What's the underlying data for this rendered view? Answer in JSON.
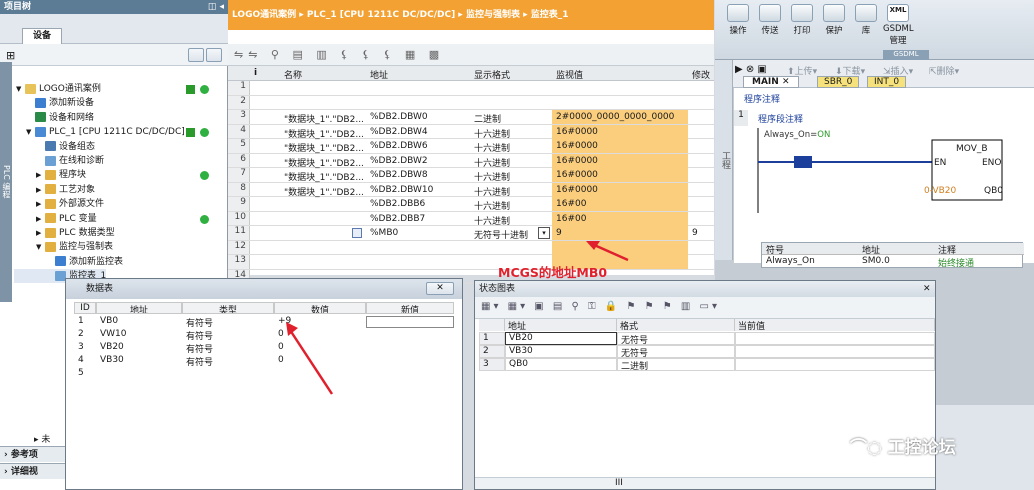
{
  "left": {
    "title": "项目树",
    "tab": "设备",
    "side_label": "PLC 编程",
    "items": [
      {
        "t": "LOGO通讯案例",
        "lvl": 0,
        "ic": "#e8c35a",
        "exp": "▼"
      },
      {
        "t": "添加新设备",
        "lvl": 1,
        "ic": "#3c7fd0"
      },
      {
        "t": "设备和网络",
        "lvl": 1,
        "ic": "#2a8a48"
      },
      {
        "t": "PLC_1 [CPU 1211C DC/DC/DC]",
        "lvl": 1,
        "ic": "#4a8ad4",
        "exp": "▼"
      },
      {
        "t": "设备组态",
        "lvl": 2,
        "ic": "#4a7ab0"
      },
      {
        "t": "在线和诊断",
        "lvl": 2,
        "ic": "#6ba0d4"
      },
      {
        "t": "程序块",
        "lvl": 2,
        "ic": "#e2b040",
        "exp": "▶"
      },
      {
        "t": "工艺对象",
        "lvl": 2,
        "ic": "#e2b040",
        "exp": "▶"
      },
      {
        "t": "外部源文件",
        "lvl": 2,
        "ic": "#e2b040",
        "exp": "▶"
      },
      {
        "t": "PLC 变量",
        "lvl": 2,
        "ic": "#e2b040",
        "exp": "▶"
      },
      {
        "t": "PLC 数据类型",
        "lvl": 2,
        "ic": "#e2b040",
        "exp": "▶"
      },
      {
        "t": "监控与强制表",
        "lvl": 2,
        "ic": "#e2b040",
        "exp": "▼"
      },
      {
        "t": "添加新监控表",
        "lvl": 3,
        "ic": "#3c7fd0"
      },
      {
        "t": "监控表_1",
        "lvl": 3,
        "ic": "#6ba0d4"
      }
    ],
    "bottom": [
      "参考项",
      "详细视"
    ],
    "bottom_mid": "未"
  },
  "mid": {
    "breadcrumb": "LOGO通讯案例 ▸ PLC_1 [CPU 1211C DC/DC/DC] ▸ 监控与强制表 ▸ 监控表_1",
    "cols": [
      "i",
      "名称",
      "地址",
      "显示格式",
      "监视值",
      "修改"
    ],
    "rows": [
      [
        "1",
        "",
        "",
        "",
        "",
        ""
      ],
      [
        "2",
        "",
        "",
        "",
        "",
        ""
      ],
      [
        "3",
        "\"数据块_1\".\"DB2...",
        "%DB2.DBW0",
        "二进制",
        "2#0000_0000_0000_0000",
        ""
      ],
      [
        "4",
        "\"数据块_1\".\"DB2...",
        "%DB2.DBW4",
        "十六进制",
        "16#0000",
        ""
      ],
      [
        "5",
        "\"数据块_1\".\"DB2...",
        "%DB2.DBW6",
        "十六进制",
        "16#0000",
        ""
      ],
      [
        "6",
        "\"数据块_1\".\"DB2...",
        "%DB2.DBW2",
        "十六进制",
        "16#0000",
        ""
      ],
      [
        "7",
        "\"数据块_1\".\"DB2...",
        "%DB2.DBW8",
        "十六进制",
        "16#0000",
        ""
      ],
      [
        "8",
        "\"数据块_1\".\"DB2...",
        "%DB2.DBW10",
        "十六进制",
        "16#0000",
        ""
      ],
      [
        "9",
        "",
        "%DB2.DBB6",
        "十六进制",
        "16#00",
        ""
      ],
      [
        "10",
        "",
        "%DB2.DBB7",
        "十六进制",
        "16#00",
        ""
      ],
      [
        "11",
        "",
        "%MB0",
        "无符号十进制",
        "9",
        "9"
      ],
      [
        "12",
        "",
        "",
        "",
        "",
        ""
      ],
      [
        "13",
        "",
        "",
        "",
        "",
        ""
      ],
      [
        "14",
        "",
        "",
        "",
        "",
        ""
      ]
    ],
    "annotation": "MCGS的地址MB0"
  },
  "pop1": {
    "title": "数据表",
    "cols": [
      "ID",
      "地址",
      "类型",
      "数值",
      "新值"
    ],
    "rows": [
      [
        "1",
        "VB0",
        "有符号",
        "+9",
        ""
      ],
      [
        "2",
        "VW10",
        "有符号",
        "0",
        ""
      ],
      [
        "3",
        "VB20",
        "有符号",
        "0",
        ""
      ],
      [
        "4",
        "VB30",
        "有符号",
        "0",
        ""
      ],
      [
        "5",
        "",
        "",
        "",
        ""
      ]
    ]
  },
  "pop2": {
    "title": "状态图表",
    "cols": [
      "地址",
      "格式",
      "当前值"
    ],
    "rows": [
      [
        "1",
        "VB20",
        "无符号",
        ""
      ],
      [
        "2",
        "VB30",
        "无符号",
        ""
      ],
      [
        "3",
        "QB0",
        "二进制",
        ""
      ]
    ],
    "scroll": "III"
  },
  "right": {
    "ribbon": [
      "操作",
      "传送",
      "打印",
      "保护",
      "库",
      "GSDML\n管理"
    ],
    "xml": "XML",
    "gsdml": "GSDML",
    "tb": [
      "上传",
      "下载",
      "插入",
      "删除"
    ],
    "tabs": [
      "MAIN",
      "SBR_0",
      "INT_0"
    ],
    "prog_comment": "程序注释",
    "net_no": "1",
    "net_comment": "程序段注释",
    "contact": "Always_On=ON",
    "mov": "MOV_B",
    "en": "EN",
    "eno": "ENO",
    "in": "0-VB20",
    "out": "QB0",
    "sym_cols": [
      "符号",
      "地址",
      "注释"
    ],
    "sym_row": [
      "Always_On",
      "SM0.0",
      "始终接通"
    ],
    "side": "工程"
  },
  "watermark": "工控论坛"
}
